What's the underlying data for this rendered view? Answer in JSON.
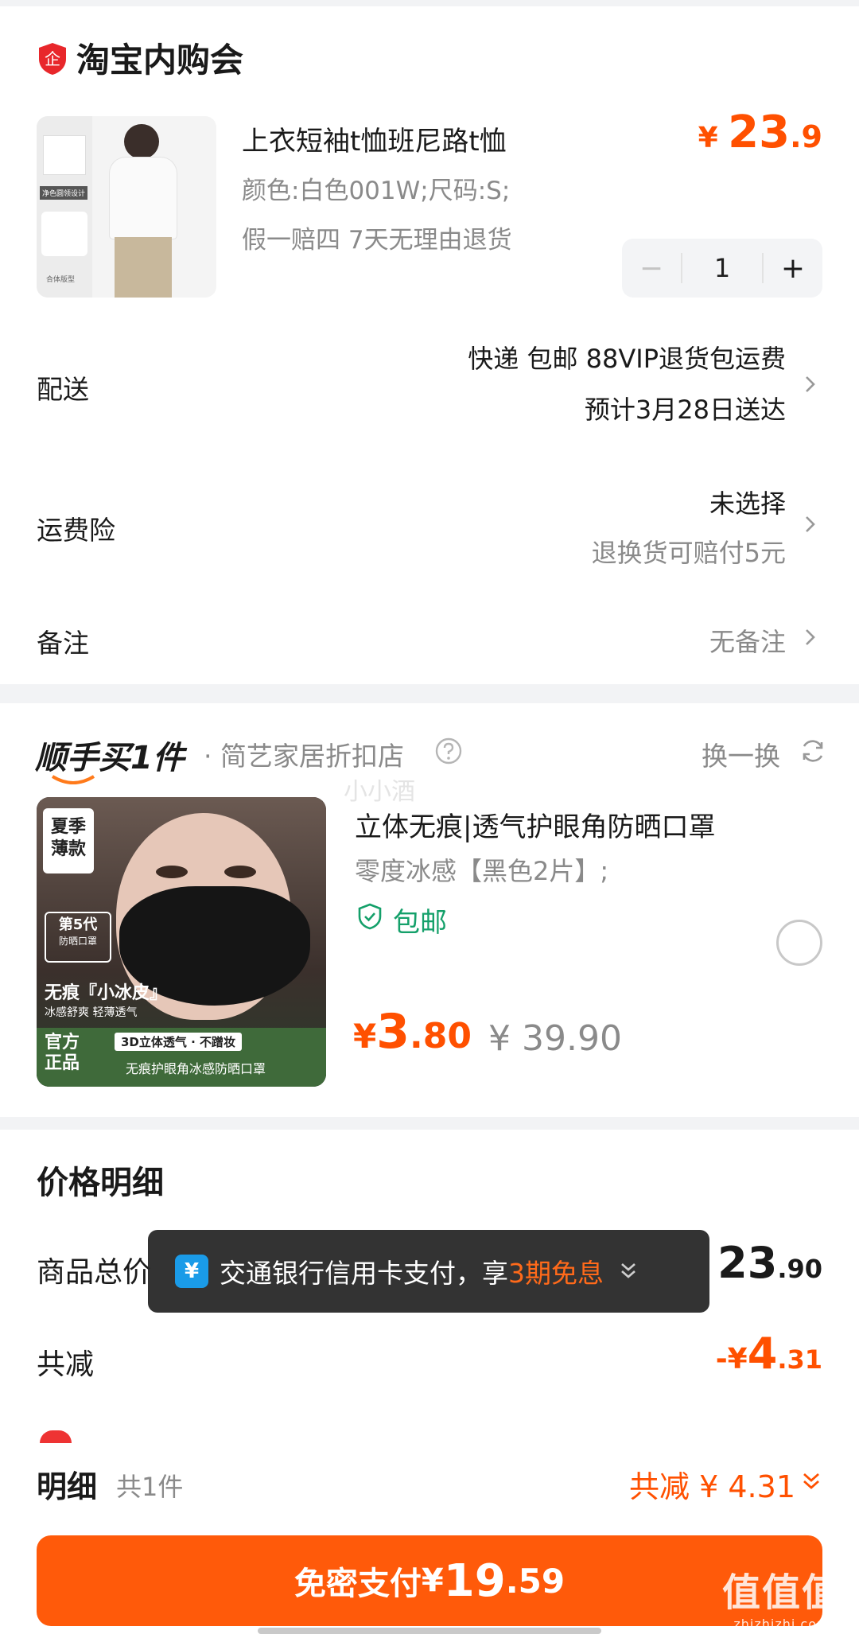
{
  "store": {
    "name": "淘宝内购会",
    "icon": "enterprise-shield-icon",
    "icon_char": "企"
  },
  "product": {
    "title": "上衣短袖t恤班尼路t恤",
    "sku": "颜色:白色001W;尺码:S;",
    "tags": "假一赔四  7天无理由退货",
    "price_currency": "¥ ",
    "price_int": "23",
    "price_dec": ".9",
    "image_label_1": "净色圆领设计",
    "image_label_2": "合体版型",
    "quantity": "1",
    "minus": "−",
    "plus": "+"
  },
  "delivery": {
    "label": "配送",
    "line1": "快递 包邮 88VIP退货包运费",
    "line2": "预计3月28日送达"
  },
  "insurance": {
    "label": "运费险",
    "line1": "未选择",
    "line2": "退换货可赔付5元"
  },
  "note": {
    "label": "备注",
    "value": "无备注"
  },
  "addon": {
    "logo": "顺手买1件",
    "shop": "· 简艺家居折扣店",
    "swap": "换一换",
    "watermark": "小小酒",
    "title": "立体无痕|透气护眼角防晒口罩",
    "sku": "零度冰感【黑色2片】;",
    "shipping": "包邮",
    "price_currency": "¥",
    "price_int": "3",
    "price_dec": ".80",
    "orig_price": "¥ 39.90",
    "img_badge": "夏季\n薄款",
    "img_gen": "第5代",
    "img_gen_sub": "防晒口罩",
    "img_line1": "无痕『小冰皮』",
    "img_line2": "冰感舒爽 轻薄透气",
    "img_official": "官方\n正品",
    "img_tag1": "3D立体透气 · 不蹭妆",
    "img_tag2": "无痕护眼角冰感防晒口罩"
  },
  "price_detail": {
    "title": "价格明细",
    "goods_total_label": "商品总价",
    "goods_total_int": "23",
    "goods_total_dec": ".90",
    "discount_label": "共减",
    "discount_prefix": "-¥",
    "discount_int": "4",
    "discount_dec": ".31"
  },
  "toast": {
    "icon_char": "¥",
    "text": "交通银行信用卡支付，享",
    "highlight": "3期免息"
  },
  "summary": {
    "label": "明细",
    "count": "共1件",
    "discount": "共减 ¥ 4.31"
  },
  "pay_button": {
    "label": "免密支付",
    "currency": "¥",
    "int": "19",
    "dec": ".59"
  },
  "brand_watermark": {
    "big": "值值值",
    "small": "zhizhizhi.com"
  },
  "colors": {
    "accent": "#ff5000",
    "green": "#14a06a",
    "button": "#ff5a0a"
  }
}
